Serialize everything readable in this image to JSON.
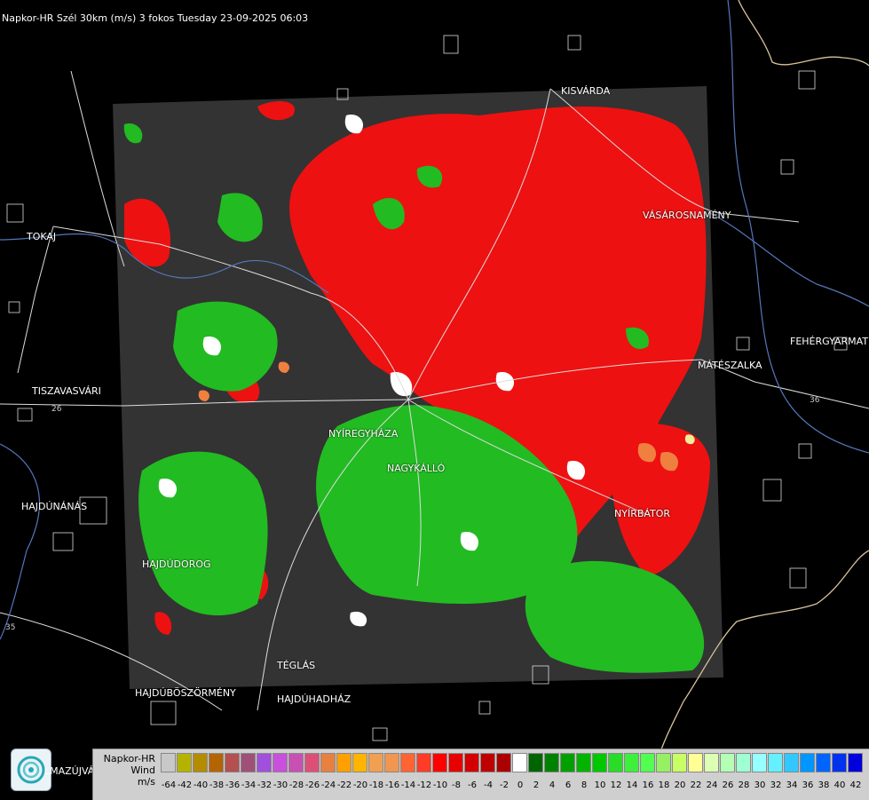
{
  "title": "Napkor-HR Szél 30km (m/s) 3 fokos Tuesday 23-09-2025 06:03",
  "cities": [
    {
      "name": "KISVÁRDA"
    },
    {
      "name": "VÁSÁROSNAMÉNY"
    },
    {
      "name": "TOKAJ"
    },
    {
      "name": "FEHÉRGYARMAT"
    },
    {
      "name": "MÁTÉSZALKA"
    },
    {
      "name": "TISZAVASVÁRI"
    },
    {
      "name": "NYÍREGYHÁZA"
    },
    {
      "name": "NAGYKÁLLÓ"
    },
    {
      "name": "HAJDÚNÁNÁS"
    },
    {
      "name": "NYÍRBÁTOR"
    },
    {
      "name": "HAJDÚDOROG"
    },
    {
      "name": "TÉGLÁS"
    },
    {
      "name": "HAJDÚBÖSZÖRMÉNY"
    },
    {
      "name": "HAJDÚHADHÁZ"
    }
  ],
  "road_numbers": [
    "26",
    "36",
    "35"
  ],
  "logo_text": "LMAZÚJVÁR",
  "legend": {
    "label_lines": [
      "Napkor-HR",
      "Wind",
      "m/s"
    ],
    "ticks": [
      "-64",
      "-42",
      "-40",
      "-38",
      "-36",
      "-34",
      "-32",
      "-30",
      "-28",
      "-26",
      "-24",
      "-22",
      "-20",
      "-18",
      "-16",
      "-14",
      "-12",
      "-10",
      "-8",
      "-6",
      "-4",
      "-2",
      "0",
      "2",
      "4",
      "6",
      "8",
      "10",
      "12",
      "14",
      "16",
      "18",
      "20",
      "22",
      "24",
      "26",
      "28",
      "30",
      "32",
      "34",
      "36",
      "38",
      "40",
      "42"
    ],
    "colors": [
      "#c8c8c8",
      "#b4b400",
      "#b48c00",
      "#b46400",
      "#b45050",
      "#a05078",
      "#a050dc",
      "#c850dc",
      "#c850b4",
      "#dc5078",
      "#e88040",
      "#ffa000",
      "#ffb400",
      "#f0a050",
      "#f09650",
      "#ff6432",
      "#ff3c28",
      "#ff0000",
      "#e60000",
      "#d20000",
      "#be0000",
      "#aa0000",
      "#ffffff",
      "#006400",
      "#008200",
      "#00a000",
      "#00b400",
      "#00c800",
      "#28dc28",
      "#3cf03c",
      "#50ff50",
      "#96f064",
      "#c8ff64",
      "#ffff96",
      "#dcffb4",
      "#b4ffb4",
      "#a0ffd2",
      "#96ffff",
      "#64f0ff",
      "#32c8ff",
      "#0096ff",
      "#0064ff",
      "#0032f0",
      "#0000dc"
    ]
  }
}
